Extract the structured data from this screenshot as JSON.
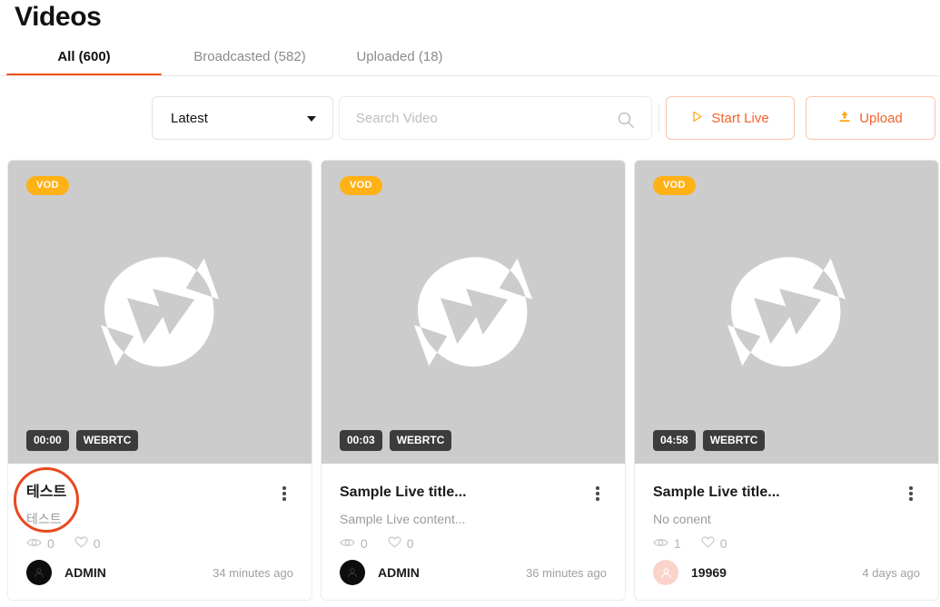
{
  "header": {
    "title": "Videos"
  },
  "tabs": [
    {
      "label": "All (600)",
      "active": true
    },
    {
      "label": "Broadcasted (582)",
      "active": false
    },
    {
      "label": "Uploaded (18)",
      "active": false
    }
  ],
  "toolbar": {
    "sort": {
      "selected": "Latest",
      "icon": "chevron-down-icon"
    },
    "search": {
      "value": "",
      "placeholder": "Search Video",
      "icon": "search-icon"
    },
    "start_live": {
      "label": "Start Live",
      "icon": "play-icon"
    },
    "upload": {
      "label": "Upload",
      "icon": "upload-icon"
    }
  },
  "colors": {
    "accent": "#f4511e",
    "button_text": "#f4622a",
    "button_border": "#f9c6ab",
    "vod_badge": "#ffb116",
    "icon_amber": "#ffa91f",
    "thumb": "#cccccc",
    "meta_badge": "#3c3c3c",
    "annotation": "#e8491e",
    "avatar_pink": "#fad3cb"
  },
  "annotation": {
    "shape": "circle",
    "color": "#e8491e",
    "target": "card-1-title"
  },
  "cards": [
    {
      "badge": "VOD",
      "duration": "00:00",
      "protocol": "WEBRTC",
      "title": "테스트",
      "description": "테스트",
      "views": "0",
      "likes": "0",
      "owner": "ADMIN",
      "avatar_type": "dark",
      "time": "34 minutes ago"
    },
    {
      "badge": "VOD",
      "duration": "00:03",
      "protocol": "WEBRTC",
      "title": "Sample Live title...",
      "description": "Sample Live content...",
      "views": "0",
      "likes": "0",
      "owner": "ADMIN",
      "avatar_type": "dark",
      "time": "36 minutes ago"
    },
    {
      "badge": "VOD",
      "duration": "04:58",
      "protocol": "WEBRTC",
      "title": "Sample Live title...",
      "description": "No conent",
      "views": "1",
      "likes": "0",
      "owner": "19969",
      "avatar_type": "pink",
      "time": "4 days ago"
    }
  ]
}
